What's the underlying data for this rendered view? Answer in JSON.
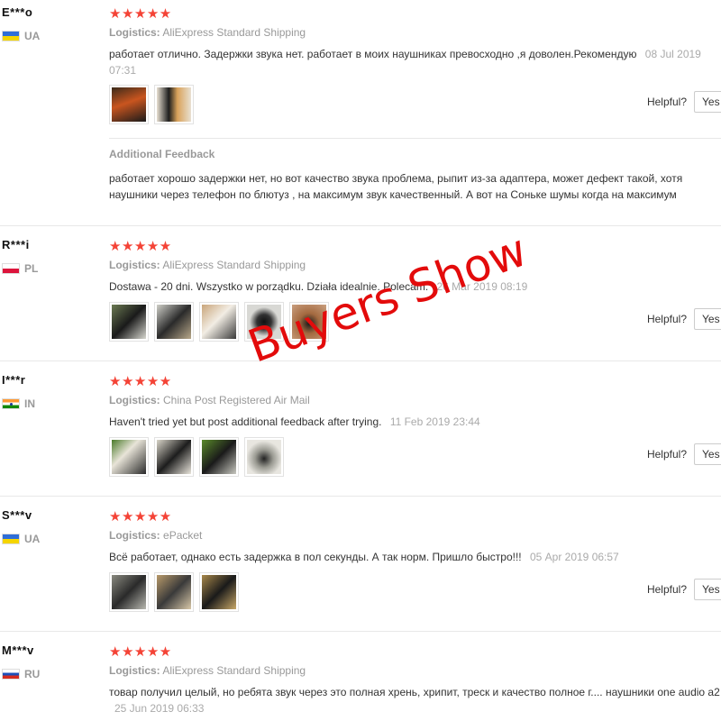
{
  "watermark": "Buyers Show",
  "colors": {
    "stars": "#f44336",
    "watermark": "#e30b0b",
    "muted": "#999999"
  },
  "helpful_label": "Helpful?",
  "yes_label": "Yes",
  "logistics_label": "Logistics:",
  "reviews": [
    {
      "user": "E***o",
      "country": "UA",
      "stars": "★★★★★",
      "rating": 5,
      "logistics": "AliExpress Standard Shipping",
      "text": "работает отлично. Задержки звука нет. работает в моих наушниках превосходно ,я доволен.Рекомендую",
      "date": "08 Jul 2019 07:31",
      "additional_label": "Additional Feedback",
      "additional_text": "работает хорошо задержки нет, но вот качество звука проблема, рыпит из-за адаптера, может дефект такой, хотя наушники через телефон по блютуз , на максимум звук качественный. А вот на Соньке шумы когда на максимум"
    },
    {
      "user": "R***i",
      "country": "PL",
      "stars": "★★★★★",
      "rating": 5,
      "logistics": "AliExpress Standard Shipping",
      "text": "Dostawa - 20 dni. Wszystko w porządku. Działa idealnie. Polecam.",
      "date": "26 Mar 2019 08:19"
    },
    {
      "user": "I***r",
      "country": "IN",
      "stars": "★★★★★",
      "rating": 5,
      "logistics": "China Post Registered Air Mail",
      "text": "Haven't tried yet but post additional feedback after trying.",
      "date": "11 Feb 2019 23:44"
    },
    {
      "user": "S***v",
      "country": "UA",
      "stars": "★★★★★",
      "rating": 5,
      "logistics": "ePacket",
      "text": "Всё работает, однако есть задержка в пол секунды. А так норм. Пришло быстро!!!",
      "date": "05 Apr 2019 06:57"
    },
    {
      "user": "M***v",
      "country": "RU",
      "stars": "★★★★★",
      "rating": 5,
      "logistics": "AliExpress Standard Shipping",
      "text": "товар получил целый, но ребята звук через это полная хрень, хрипит, треск и качество полное г.... наушники one audio a2",
      "date": "25 Jun 2019 06:33"
    }
  ]
}
